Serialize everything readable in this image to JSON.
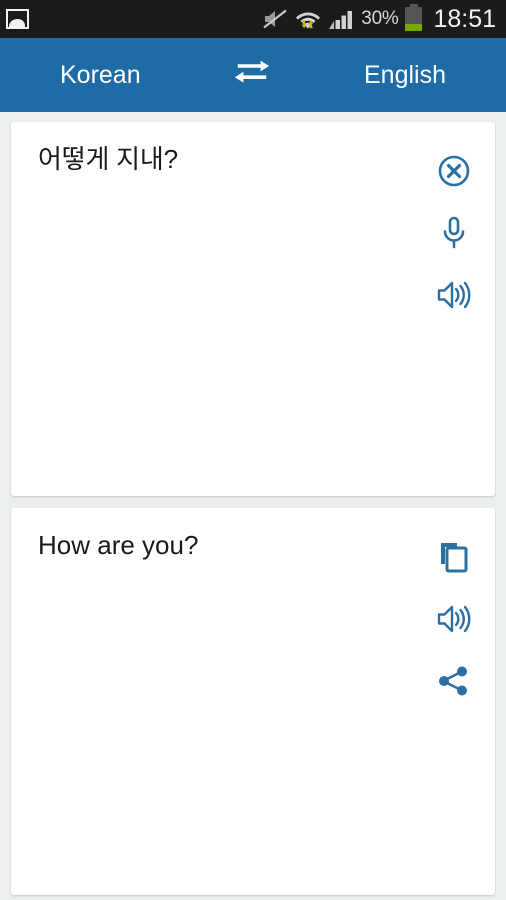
{
  "status_bar": {
    "notification_icon": "gallery-image-icon",
    "mute_icon": "volume-mute-icon",
    "wifi_icon": "wifi-signal-icon",
    "signal_icon": "cellular-signal-icon",
    "battery_percent_label": "30%",
    "battery_level": 30,
    "clock": "18:51"
  },
  "appbar": {
    "source_language": "Korean",
    "target_language": "English",
    "swap_icon": "swap-horizontal-arrows-icon",
    "background_color": "#1f6ba5"
  },
  "source_card": {
    "text": "어떻게 지내?",
    "actions": [
      {
        "name": "clear",
        "icon": "clear-circle-x-icon"
      },
      {
        "name": "voice-input",
        "icon": "microphone-icon"
      },
      {
        "name": "speak",
        "icon": "speaker-volume-icon"
      }
    ]
  },
  "target_card": {
    "text": "How are you?",
    "actions": [
      {
        "name": "copy",
        "icon": "copy-icon"
      },
      {
        "name": "speak",
        "icon": "speaker-volume-icon"
      },
      {
        "name": "share",
        "icon": "share-nodes-icon"
      }
    ]
  },
  "colors": {
    "accent": "#1f6ba5",
    "icon_blue": "#2b6fa3",
    "page_background": "#eceff0",
    "card_background": "#ffffff",
    "status_bar_background": "#1b1b1b",
    "battery_green": "#78a700",
    "wifi_arrow_yellow": "#d9b300"
  }
}
